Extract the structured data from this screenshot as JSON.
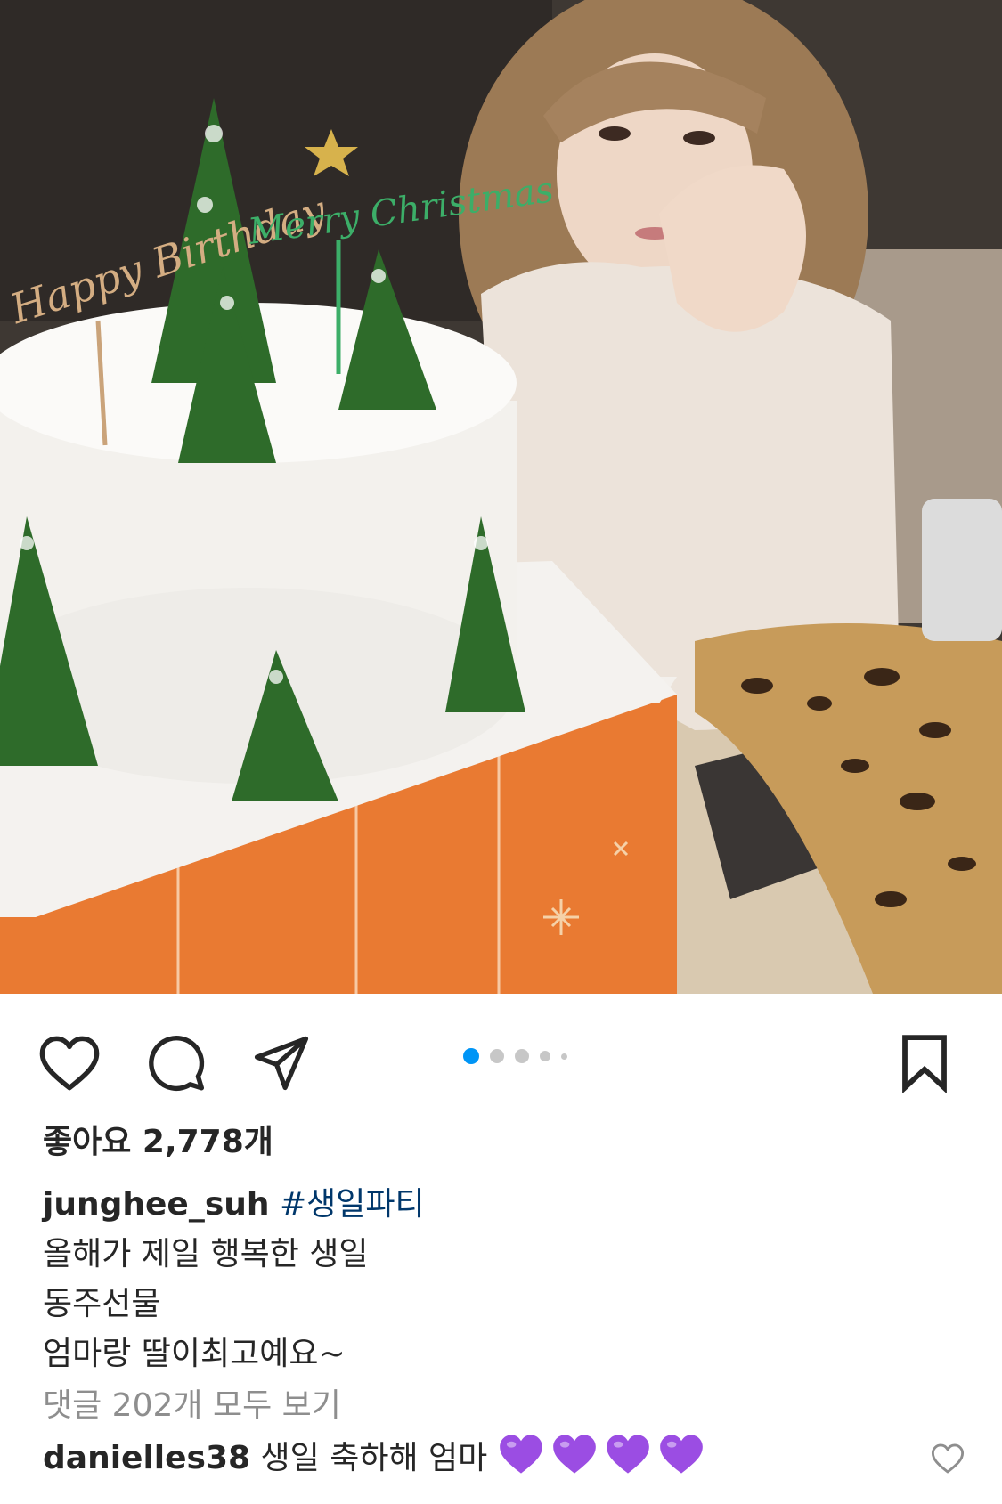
{
  "post": {
    "likes_text": "좋아요 2,778개",
    "username": "junghee_suh",
    "hashtag": "#생일파티",
    "caption_lines": [
      "올해가 제일 행복한 생일",
      "동주선물",
      "엄마랑 딸이최고예요~"
    ],
    "view_comments": "댓글 202개 모두 보기"
  },
  "carousel": {
    "count": 5,
    "active_index": 0,
    "active_color": "#0095f6",
    "inactive_color": "#c7c7c7"
  },
  "comment": {
    "username": "danielles38",
    "text": "생일 축하해 엄마",
    "emoji_name": "purple-heart",
    "emoji_count": 4,
    "emoji_color": "#9b4de3"
  },
  "icons": {
    "like": "heart-outline-icon",
    "comment": "speech-bubble-icon",
    "share": "paper-plane-icon",
    "save": "bookmark-icon"
  },
  "photo": {
    "cake_topper_1": "Happy Birthday",
    "cake_topper_2": "Merry Christmas"
  }
}
